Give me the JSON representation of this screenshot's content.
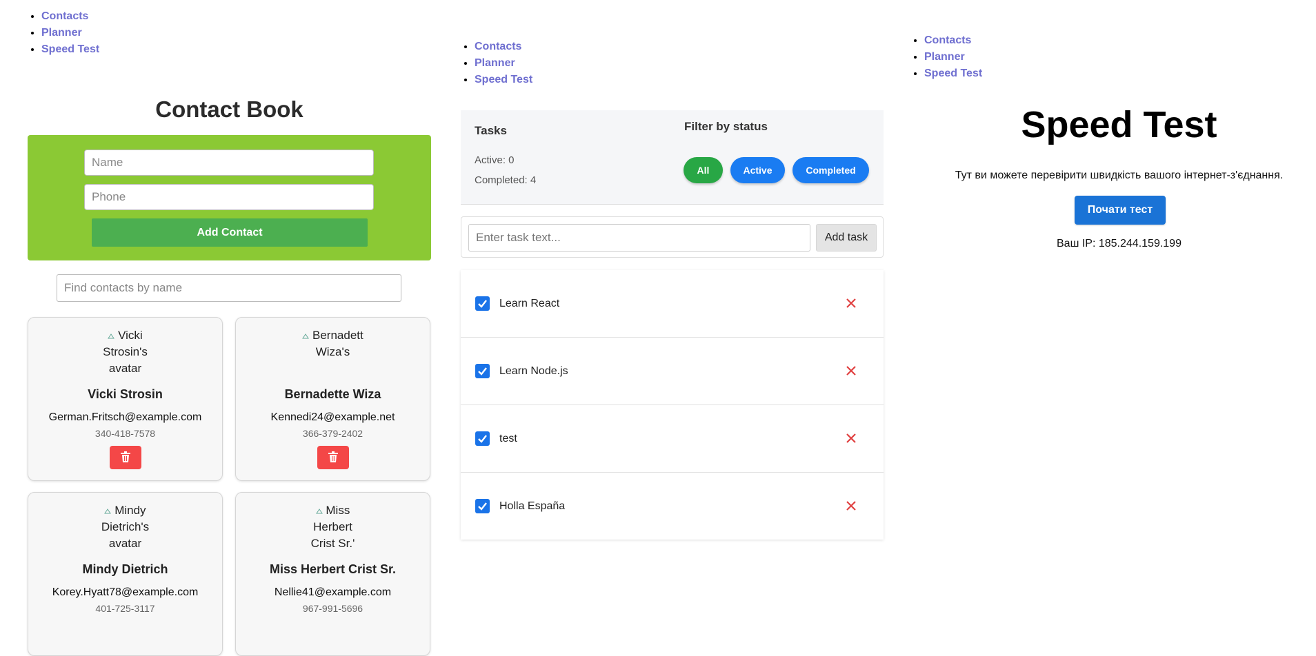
{
  "nav": {
    "links": [
      "Contacts",
      "Planner",
      "Speed Test"
    ]
  },
  "contact_book": {
    "title": "Contact Book",
    "name_placeholder": "Name",
    "phone_placeholder": "Phone",
    "add_label": "Add Contact",
    "search_placeholder": "Find contacts by name",
    "form_color": "#8bc934",
    "contacts": [
      {
        "avatar_alt": "Vicki Strosin's avatar",
        "name": "Vicki Strosin",
        "email": "German.Fritsch@example.com",
        "phone": "340-418-7578"
      },
      {
        "avatar_alt": "Bernadett Wiza's",
        "name": "Bernadette Wiza",
        "email": "Kennedi24@example.net",
        "phone": "366-379-2402"
      },
      {
        "avatar_alt": "Mindy Dietrich's avatar",
        "name": "Mindy Dietrich",
        "email": "Korey.Hyatt78@example.com",
        "phone": "401-725-3117"
      },
      {
        "avatar_alt": "Miss Herbert Crist Sr.'",
        "name": "Miss Herbert Crist Sr.",
        "email": "Nellie41@example.com",
        "phone": "967-991-5696"
      }
    ],
    "delete_icon": "trash-icon"
  },
  "planner": {
    "tasks_title": "Tasks",
    "active_text": "Active: 0",
    "completed_text": "Completed: 4",
    "filter_title": "Filter by status",
    "filters": [
      {
        "label": "All",
        "color": "#28a745"
      },
      {
        "label": "Active",
        "color": "#1a7cf2"
      },
      {
        "label": "Completed",
        "color": "#1a7cf2"
      }
    ],
    "input_placeholder": "Enter task text...",
    "add_label": "Add task",
    "tasks": [
      {
        "text": "Learn React",
        "checked": true
      },
      {
        "text": "Learn Node.js",
        "checked": true
      },
      {
        "text": "test",
        "checked": true
      },
      {
        "text": "Holla España",
        "checked": true
      }
    ],
    "delete_color": "#e04040"
  },
  "speed_test": {
    "title": "Speed Test",
    "description": "Тут ви можете перевірити швидкість вашого інтернет-з'єднання.",
    "button_label": "Почати тест",
    "ip_text": "Ваш IP: 185.244.159.199"
  }
}
